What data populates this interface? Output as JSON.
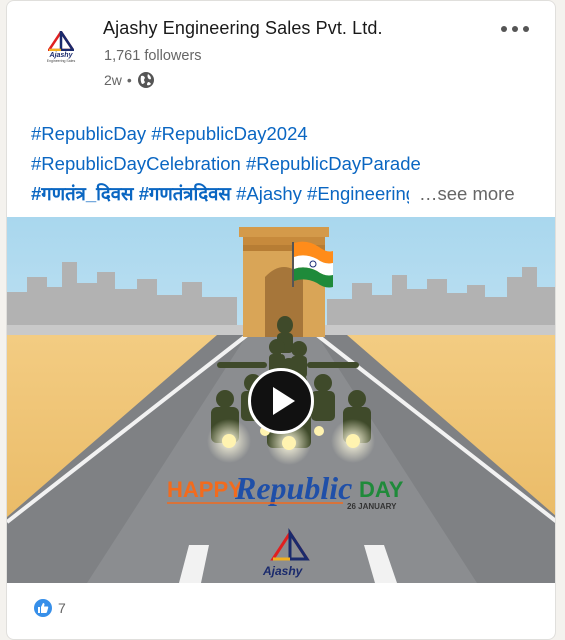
{
  "post": {
    "company_name": "Ajashy Engineering Sales Pvt. Ltd.",
    "followers": "1,761 followers",
    "time_ago": "2w",
    "separator": "•",
    "visibility_icon": "globe-icon",
    "menu_icon": "more-horizontal-icon",
    "logo": {
      "name": "Ajashy",
      "sub": "Engineering Sales"
    },
    "hashtags_line1": [
      "#RepublicDay",
      "#RepublicDay2024"
    ],
    "hashtags_line2": [
      "#RepublicDayCelebration",
      "#RepublicDayParade"
    ],
    "hashtags_line3": [
      "#गणतंत्र_दिवस",
      "#गणतंत्रदिवस",
      "#Ajashy",
      "#Engineering"
    ],
    "see_more": "…see more",
    "reactions": {
      "icon": "like-icon",
      "count": "7"
    }
  },
  "media": {
    "play_icon": "play-icon",
    "banner_happy": "HAPPY",
    "banner_republic": "Republic",
    "banner_day": "DAY",
    "banner_date": "26 JANUARY",
    "watermark": "Ajashy"
  },
  "colors": {
    "link": "#0a66c2",
    "secondary_text": "#666666",
    "like_blue": "#378fe9"
  }
}
